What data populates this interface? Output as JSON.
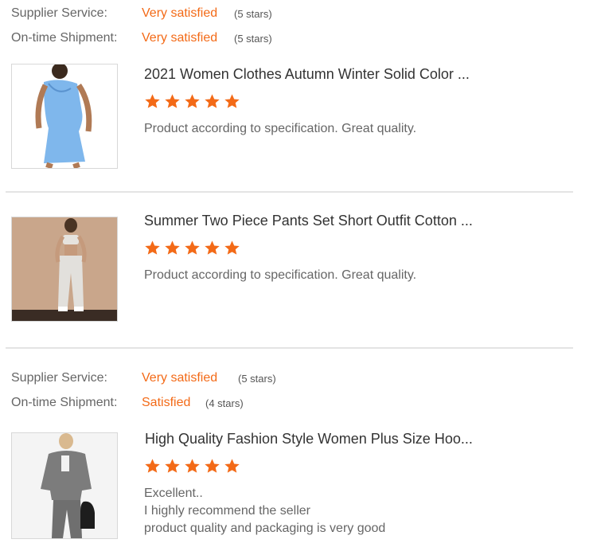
{
  "colors": {
    "accent": "#f36a17",
    "text": "#666666",
    "divider": "#e4e4e4"
  },
  "group_a": {
    "ratings": [
      {
        "label": "Supplier Service:",
        "value": "Very satisfied",
        "stars": "(5 stars)"
      },
      {
        "label": "On-time Shipment:",
        "value": "Very satisfied",
        "stars": "(5 stars)"
      }
    ]
  },
  "reviews": [
    {
      "title": "2021 Women Clothes Autumn Winter Solid Color ...",
      "rating": 5,
      "text_lines": [
        "Product according to specification. Great quality."
      ]
    },
    {
      "title": "Summer Two Piece Pants Set Short Outfit Cotton ...",
      "rating": 5,
      "text_lines": [
        "Product according to specification. Great quality."
      ]
    }
  ],
  "group_b": {
    "ratings": [
      {
        "label": "Supplier Service:",
        "value": "Very satisfied",
        "stars": "(5 stars)"
      },
      {
        "label": "On-time Shipment:",
        "value": "Satisfied",
        "stars": "(4 stars)"
      }
    ],
    "review": {
      "title": "High Quality Fashion Style Women Plus Size Hoo...",
      "rating": 5,
      "text_lines": [
        "Excellent..",
        "I highly recommend the seller",
        "product quality and packaging is very good"
      ]
    }
  }
}
